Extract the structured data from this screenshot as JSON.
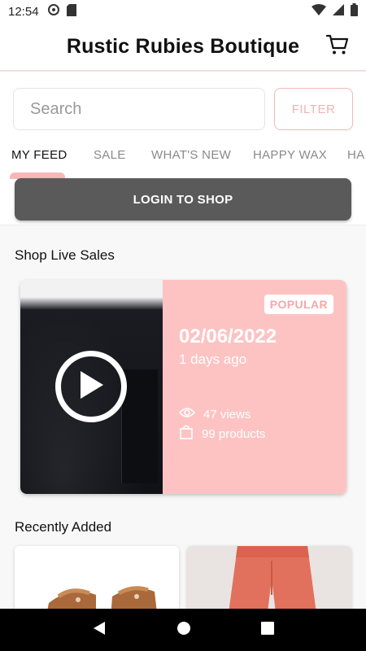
{
  "status_bar": {
    "time": "12:54",
    "left_icons": [
      "sync-icon",
      "sd-card-icon"
    ],
    "right_icons": [
      "wifi-icon",
      "signal-icon",
      "battery-icon"
    ]
  },
  "header": {
    "title": "Rustic Rubies Boutique",
    "cart_icon": "cart-icon"
  },
  "search": {
    "placeholder": "Search",
    "value": "",
    "filter_label": "FILTER"
  },
  "tabs": [
    {
      "label": "MY FEED",
      "active": true
    },
    {
      "label": "SALE",
      "active": false
    },
    {
      "label": "WHAT'S NEW",
      "active": false
    },
    {
      "label": "HAPPY WAX",
      "active": false
    },
    {
      "label": "HA",
      "active": false
    }
  ],
  "login_button": "LOGIN TO SHOP",
  "live_sales": {
    "title": "Shop Live Sales",
    "card": {
      "badge": "POPULAR",
      "date": "02/06/2022",
      "ago": "1 days ago",
      "views": "47 views",
      "products": "99 products"
    }
  },
  "recently_added": {
    "title": "Recently Added"
  },
  "colors": {
    "accent_pink": "#fdc3c3",
    "filter_pink": "#f3b3b3",
    "login_gray": "#5a5a5a"
  }
}
